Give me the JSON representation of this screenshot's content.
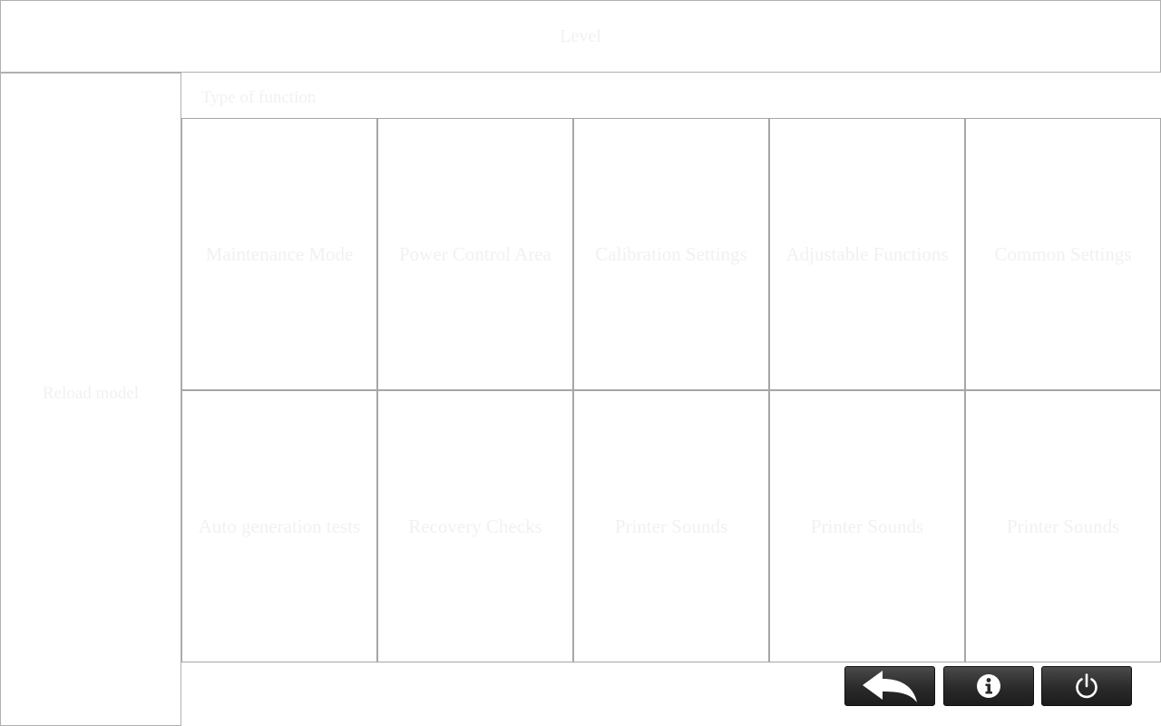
{
  "header": {
    "title": "Level"
  },
  "sidebar": {
    "label": "Reload model"
  },
  "section": {
    "title": "Type of function"
  },
  "tiles": [
    {
      "label": "Maintenance Mode"
    },
    {
      "label": "Power Control Area"
    },
    {
      "label": "Calibration Settings"
    },
    {
      "label": "Adjustable Functions"
    },
    {
      "label": "Common Settings"
    },
    {
      "label": "Auto generation tests"
    },
    {
      "label": "Recovery Checks"
    },
    {
      "label": "Printer Sounds"
    },
    {
      "label": "Printer Sounds"
    },
    {
      "label": "Printer Sounds"
    }
  ],
  "toolbar": {
    "back_icon": "back-arrow-icon",
    "info_icon": "info-icon",
    "power_icon": "power-icon"
  },
  "colors": {
    "border": "#b0b0b0",
    "text": "#f1f1f1",
    "button_dark": "#2a2a2a",
    "icon": "#ffffff"
  }
}
